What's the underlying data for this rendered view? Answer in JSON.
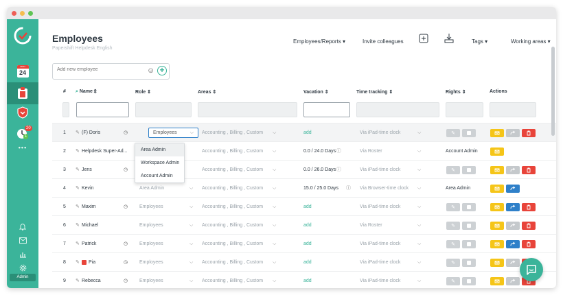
{
  "window": {
    "traffic_lights": [
      "#ee5f57",
      "#f5bd4f",
      "#5fc454"
    ]
  },
  "sidebar": {
    "calendar_month": "MON",
    "calendar_day": "24",
    "timer_badge_top": "20",
    "timer_badge_bottom": "1",
    "more_label": "•••",
    "admin_label": "Admin"
  },
  "header": {
    "title": "Employees",
    "subtitle": "Papershift Helpdesk English",
    "nav": {
      "employees_reports": "Employees/Reports",
      "invite": "Invite colleagues",
      "tags": "Tags",
      "working_areas": "Working areas"
    }
  },
  "add_employee": {
    "placeholder": "Add new employee"
  },
  "table": {
    "headers": {
      "index": "#",
      "name": "Name",
      "role": "Role",
      "areas": "Areas",
      "vacation": "Vacation",
      "time_tracking": "Time tracking",
      "rights": "Rights",
      "actions": "Actions"
    },
    "rows": [
      {
        "idx": "1",
        "name": "(F) Doris",
        "role": "Employees",
        "areas": "Accounting , Billing , Custom",
        "vacation": "add",
        "tracking": "Via iPad-time clock",
        "rights": ""
      },
      {
        "idx": "2",
        "name": "Helpdesk Super-Ad...",
        "role": "",
        "areas": "Accounting , Billing , Custom",
        "vacation": "0.0 / 24.0 Days",
        "tracking": "Via Roster",
        "rights": "Account Admin"
      },
      {
        "idx": "3",
        "name": "Jens",
        "role": "",
        "areas": "Accounting , Billing , Custom",
        "vacation": "0.0 / 26.0 Days",
        "tracking": "Via iPad-time clock",
        "rights": ""
      },
      {
        "idx": "4",
        "name": "Kevin",
        "role": "Area Admin",
        "areas": "Accounting , Billing , Custom",
        "vacation": "15.0 / 25.0 Days",
        "tracking": "Via Browser-time clock",
        "rights": "Area Admin"
      },
      {
        "idx": "5",
        "name": "Maxim",
        "role": "Employees",
        "areas": "Accounting , Billing , Custom",
        "vacation": "add",
        "tracking": "Via iPad-time clock",
        "rights": ""
      },
      {
        "idx": "6",
        "name": "Michael",
        "role": "Employees",
        "areas": "Accounting , Billing , Custom",
        "vacation": "add",
        "tracking": "Via Roster",
        "rights": ""
      },
      {
        "idx": "7",
        "name": "Patrick",
        "role": "Employees",
        "areas": "Accounting , Billing , Custom",
        "vacation": "add",
        "tracking": "Via iPad-time clock",
        "rights": ""
      },
      {
        "idx": "8",
        "name": "Pia",
        "role": "Employees",
        "areas": "Accounting , Billing , Custom",
        "vacation": "add",
        "tracking": "Via iPad-time clock",
        "rights": ""
      },
      {
        "idx": "9",
        "name": "Rebecca",
        "role": "Employees",
        "areas": "Accounting , Billing , Custom",
        "vacation": "add",
        "tracking": "Via iPad-time clock",
        "rights": ""
      }
    ]
  },
  "role_dropdown": {
    "options": [
      "Area Admin",
      "Workspace Admin",
      "Account Admin"
    ]
  },
  "colors": {
    "brand": "#3bb49a",
    "action_yellow": "#f5c518",
    "action_blue": "#2f80c9",
    "action_red": "#e8443a",
    "action_grey": "#c5c9cc"
  }
}
